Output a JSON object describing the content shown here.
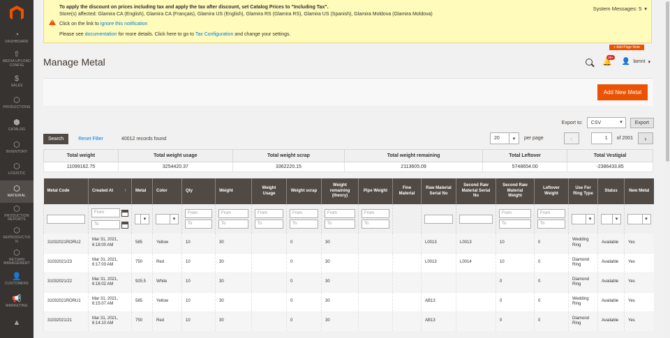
{
  "sidebar": {
    "items": [
      {
        "label": "DASHBOARD",
        "icon": "dashboard-icon",
        "glyph": "◔",
        "active": false
      },
      {
        "label": "MEDIA UPLOAD CONFIG",
        "icon": "upload-icon",
        "glyph": "⇧",
        "active": false
      },
      {
        "label": "SALES",
        "icon": "dollar-icon",
        "glyph": "$",
        "active": false
      },
      {
        "label": "PRODUCTIONS",
        "icon": "hexagon-icon",
        "glyph": "⬡",
        "active": false
      },
      {
        "label": "CATALOG",
        "icon": "cube-icon",
        "glyph": "⬢",
        "active": false
      },
      {
        "label": "INVENTORY",
        "icon": "hexagon-icon",
        "glyph": "⬡",
        "active": false
      },
      {
        "label": "LOGISTIC",
        "icon": "hexagon-icon",
        "glyph": "⬡",
        "active": false
      },
      {
        "label": "MATERIAL",
        "icon": "hexagon-icon",
        "glyph": "⬡",
        "active": true
      },
      {
        "label": "PRODUCTION REPORTS",
        "icon": "hexagon-icon",
        "glyph": "⬡",
        "active": false
      },
      {
        "label": "REPRODUCTIO N",
        "icon": "hexagon-icon",
        "glyph": "⬡",
        "active": false
      },
      {
        "label": "RETURN MANAGEMENT",
        "icon": "hexagon-icon",
        "glyph": "⬡",
        "active": false
      },
      {
        "label": "CUSTOMERS",
        "icon": "user-icon",
        "glyph": "👤",
        "active": false
      },
      {
        "label": "MARKETING",
        "icon": "megaphone-icon",
        "glyph": "📢",
        "active": false
      },
      {
        "label": "",
        "icon": "chart-icon",
        "glyph": "▲",
        "active": false
      }
    ]
  },
  "message": {
    "line1": "To apply the discount on prices including tax and apply the tax after discount, set Catalog Prices to \"Including Tax\".",
    "line2": "Store(s) affected: Glamira CA (English), Glamira CA (Français), Glamira US (English), Glamira RS (Glamira RS), Glamira US (Spanish), Glamira Moldova (Glamira Moldova)",
    "line3_prefix": "Click on the link to",
    "line3_link": "ignore this notification",
    "line4_prefix": "Please see",
    "line4_link1": "documentation",
    "line4_mid": "for more details. Click here to go to",
    "line4_link2": "Tax Configuration",
    "line4_suffix": "and change your settings.",
    "system_messages": "System Messages: 5"
  },
  "header": {
    "add_page_note": "+ Add Page Note",
    "title": "Manage Metal",
    "notification_count": "99+",
    "user": "lamnt"
  },
  "actions": {
    "add_new": "Add New Metal"
  },
  "export": {
    "label": "Export to:",
    "value": "CSV",
    "button": "Export"
  },
  "toolbar": {
    "search": "Search",
    "reset": "Reset Filter",
    "records": "40012 records found",
    "per_page_value": "20",
    "per_page_label": "per page",
    "page": "1",
    "of_pages": "of 2001",
    "prev": "‹",
    "next": "›"
  },
  "totals": {
    "headers": [
      "Total weight",
      "Total weight usage",
      "Total weight scrap",
      "Total weight remaining",
      "Total Leftover",
      "Total Vestigial"
    ],
    "values": [
      "11099162.75",
      "3254420.37",
      "3362220.15",
      "2113605.09",
      "5748654.00",
      "-2386433.85"
    ]
  },
  "grid": {
    "columns": [
      "Metal Code",
      "Created At",
      "Metal",
      "Color",
      "Qty",
      "Weight",
      "Weight Usage",
      "Weight scrap",
      "Weight remaining (theory)",
      "Pipe Weight",
      "Fine Material",
      "Raw Material Serial No",
      "Second Raw Material Serial No",
      "Second Raw Material Weight",
      "Leftover Weight",
      "Use For Ring Type",
      "Status",
      "New Metal"
    ],
    "sort_arrow": "↑",
    "filters": {
      "from": "From",
      "to": "To"
    },
    "rows": [
      {
        "code": "31032021RORU2",
        "created": "Mar 31, 2021, 6:18:00 AM",
        "metal": "585",
        "color": "Yellow",
        "qty": "10",
        "weight": "30",
        "usage": "",
        "scrap": "0",
        "remaining": "30",
        "pipe": "",
        "fine": "",
        "raw": "L0013",
        "second_raw": "L0013",
        "second_weight": "10",
        "leftover": "0",
        "ring": "Wedding Ring",
        "status": "Available",
        "new": "Yes"
      },
      {
        "code": "31032021/23",
        "created": "Mar 31, 2021, 6:17:03 AM",
        "metal": "750",
        "color": "Red",
        "qty": "10",
        "weight": "30",
        "usage": "",
        "scrap": "0",
        "remaining": "30",
        "pipe": "",
        "fine": "",
        "raw": "L0013",
        "second_raw": "L0014",
        "second_weight": "10",
        "leftover": "0",
        "ring": "Diamond Ring",
        "status": "Available",
        "new": "Yes"
      },
      {
        "code": "31032021/22",
        "created": "Mar 31, 2021, 6:16:02 AM",
        "metal": "925.5",
        "color": "White",
        "qty": "10",
        "weight": "30",
        "usage": "",
        "scrap": "0",
        "remaining": "30",
        "pipe": "",
        "fine": "",
        "raw": "",
        "second_raw": "",
        "second_weight": "0",
        "leftover": "0",
        "ring": "Diamond Ring",
        "status": "Available",
        "new": "Yes"
      },
      {
        "code": "31032021RORU1",
        "created": "Mar 31, 2021, 6:15:07 AM",
        "metal": "585",
        "color": "Yellow",
        "qty": "10",
        "weight": "30",
        "usage": "",
        "scrap": "0",
        "remaining": "30",
        "pipe": "",
        "fine": "",
        "raw": "AB13",
        "second_raw": "",
        "second_weight": "0",
        "leftover": "0",
        "ring": "Wedding Ring",
        "status": "Available",
        "new": "Yes"
      },
      {
        "code": "31032021/21",
        "created": "Mar 31, 2021, 6:14:10 AM",
        "metal": "750",
        "color": "Red",
        "qty": "10",
        "weight": "30",
        "usage": "",
        "scrap": "0",
        "remaining": "30",
        "pipe": "",
        "fine": "",
        "raw": "AB13",
        "second_raw": "",
        "second_weight": "0",
        "leftover": "0",
        "ring": "Diamond Ring",
        "status": "Available",
        "new": "Yes"
      }
    ]
  }
}
